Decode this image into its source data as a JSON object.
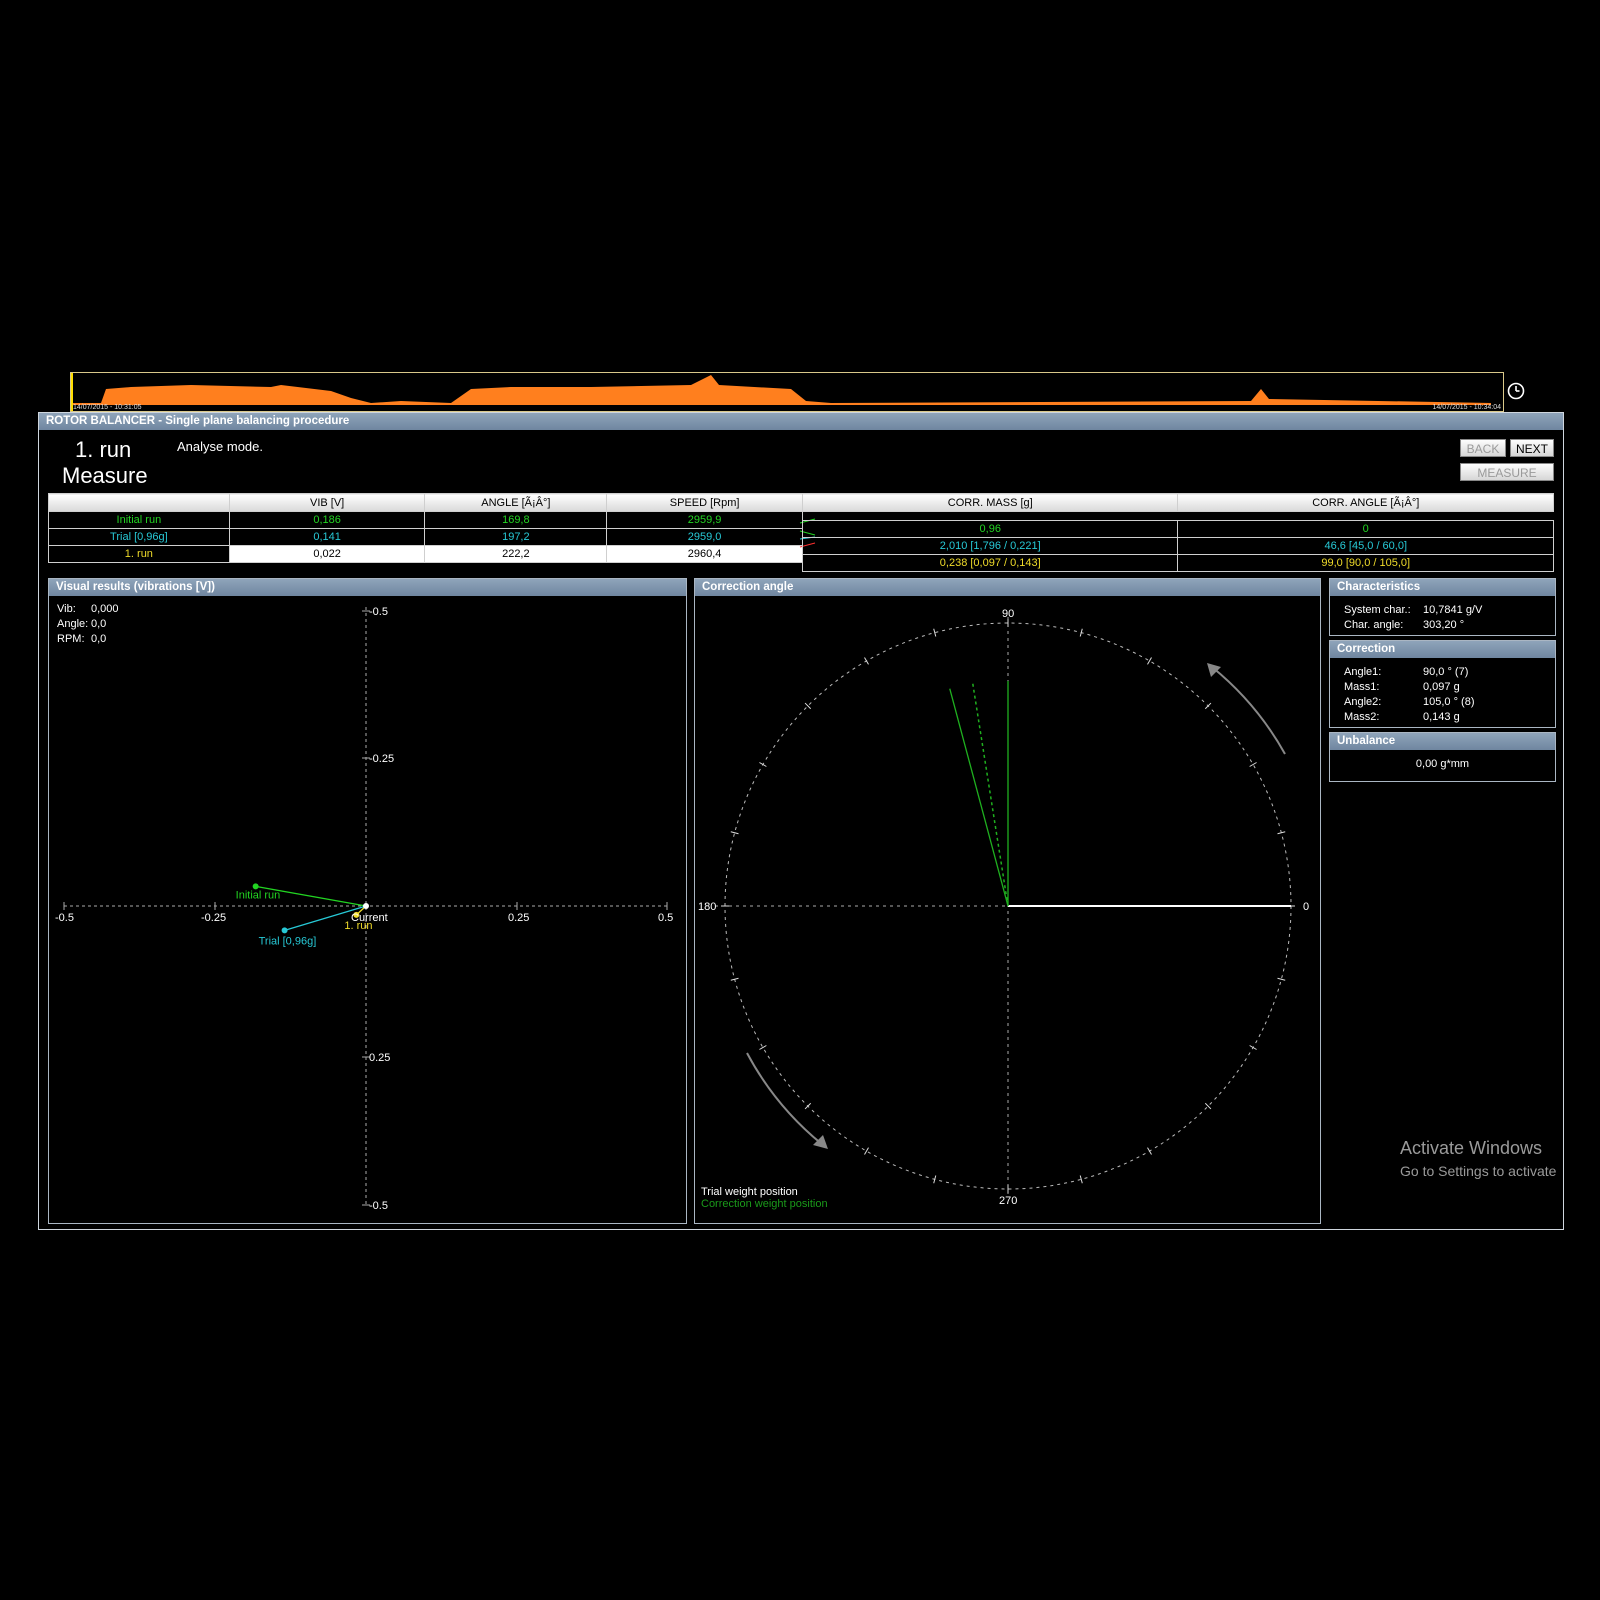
{
  "timeline": {
    "start_label": "14/07/2015 - 10:31:05",
    "end_label": "14/07/2015 - 10:34:04",
    "waveform_color": "#ff7f1e"
  },
  "window": {
    "title": "ROTOR BALANCER - Single plane balancing procedure",
    "run_title": "1. run",
    "step_title": "Measure",
    "mode_text": "Analyse mode.",
    "buttons": {
      "back": "BACK",
      "next": "NEXT",
      "measure": "MEASURE"
    }
  },
  "table": {
    "headers": [
      "",
      "VIB [V]",
      "ANGLE [Ã¡Â°]",
      "SPEED [Rpm]"
    ],
    "rows": [
      {
        "name": "Initial run",
        "vib": "0,186",
        "angle": "169,8",
        "speed": "2959,9",
        "color": "#22d422"
      },
      {
        "name": "Trial [0,96g]",
        "vib": "0,141",
        "angle": "197,2",
        "speed": "2959,0",
        "color": "#27c9d6"
      },
      {
        "name": "1. run",
        "vib": "0,022",
        "angle": "222,2",
        "speed": "2960,4",
        "color": "#f0dc2a"
      }
    ]
  },
  "corr_table": {
    "headers": [
      "CORR. MASS [g]",
      "CORR. ANGLE [Ã¡Â°]"
    ],
    "rows": [
      {
        "mass": "0,96",
        "angle": "0",
        "color": "#22d422"
      },
      {
        "mass": "2,010 [1,796 / 0,221]",
        "angle": "46,6 [45,0 / 60,0]",
        "color": "#27c9d6"
      },
      {
        "mass": "0,238 [0,097 / 0,143]",
        "angle": "99,0 [90,0 / 105,0]",
        "color": "#f0dc2a"
      }
    ]
  },
  "visual": {
    "title": "Visual results (vibrations [V])",
    "readout": {
      "vib_label": "Vib:",
      "vib": "0,000",
      "angle_label": "Angle:",
      "angle": "0,0",
      "rpm_label": "RPM:",
      "rpm": "0,0"
    },
    "x_ticks": [
      "-0.5",
      "-0.25",
      "0.25",
      "0.5"
    ],
    "y_ticks": [
      "-0.5",
      "-0.25",
      "0.25",
      "-0.5"
    ],
    "points": [
      {
        "label": "Initial run",
        "x": -0.183,
        "y": 0.033,
        "color": "#22d422"
      },
      {
        "label": "Trial [0,96g]",
        "x": -0.135,
        "y": -0.041,
        "color": "#27c9d6"
      },
      {
        "label": "1. run",
        "x": -0.016,
        "y": -0.015,
        "color": "#f0dc2a"
      }
    ],
    "current_label": "Current"
  },
  "correction_angle": {
    "title": "Correction angle",
    "labels": {
      "top": "90",
      "left": "180",
      "right": "0",
      "bottom": "270"
    },
    "legend_trial": "Trial weight position",
    "legend_correction": "Correction weight position",
    "trial_angle_deg": 0,
    "correction_angles_deg": [
      99.0,
      90.0,
      105.0
    ]
  },
  "characteristics": {
    "title": "Characteristics",
    "system_char_label": "System char.:",
    "system_char": "10,7841 g/V",
    "char_angle_label": "Char. angle:",
    "char_angle": "303,20 °"
  },
  "correction": {
    "title": "Correction",
    "angle1_label": "Angle1:",
    "angle1": "90,0 ° (7)",
    "mass1_label": "Mass1:",
    "mass1": "0,097 g",
    "angle2_label": "Angle2:",
    "angle2": "105,0 ° (8)",
    "mass2_label": "Mass2:",
    "mass2": "0,143 g"
  },
  "unbalance": {
    "title": "Unbalance",
    "value": "0,00 g*mm"
  },
  "watermark": {
    "line1": "Activate Windows",
    "line2": "Go to Settings to activate"
  }
}
